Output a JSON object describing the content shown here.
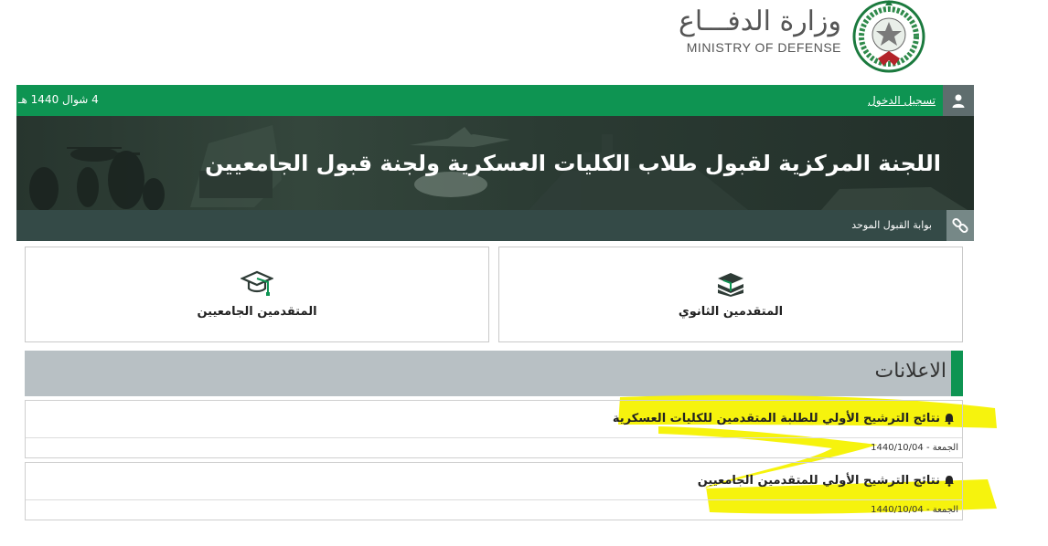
{
  "header": {
    "logo_ar": "وزارة الدفـــاع",
    "logo_en": "MINISTRY OF DEFENSE"
  },
  "topbar": {
    "login_label": "تسجيل الدخول",
    "date": "4 شوال 1440 هـ"
  },
  "banner": {
    "title": "اللجنة المركزية لقبول طلاب الكليات العسكرية ولجنة قبول الجامعيين"
  },
  "portal": {
    "label": "بوابة القبول الموحد"
  },
  "cards": {
    "secondary_label": "المتقدمين الثانوي",
    "university_label": "المتقدمين الجامعيين"
  },
  "announcements": {
    "title": "الاعلانات",
    "items": [
      {
        "title": "نتائج الترشيح الأولي للطلبة المتقدمين للكليات العسكرية",
        "day": "الجمعة",
        "date": "1440/10/04"
      },
      {
        "title": "نتائج الترشيح الأولي للمتقدمين الجامعيين",
        "day": "الجمعة",
        "date": "1440/10/04"
      }
    ]
  },
  "colors": {
    "primary_green": "#0e9452",
    "dark_bar": "#344a47",
    "announcement_header": "#b8c0c4",
    "highlight": "#f5f200"
  },
  "icons": [
    "user-icon",
    "link-icon",
    "graduation-cap-icon",
    "books-icon",
    "bell-icon",
    "ministry-emblem"
  ]
}
